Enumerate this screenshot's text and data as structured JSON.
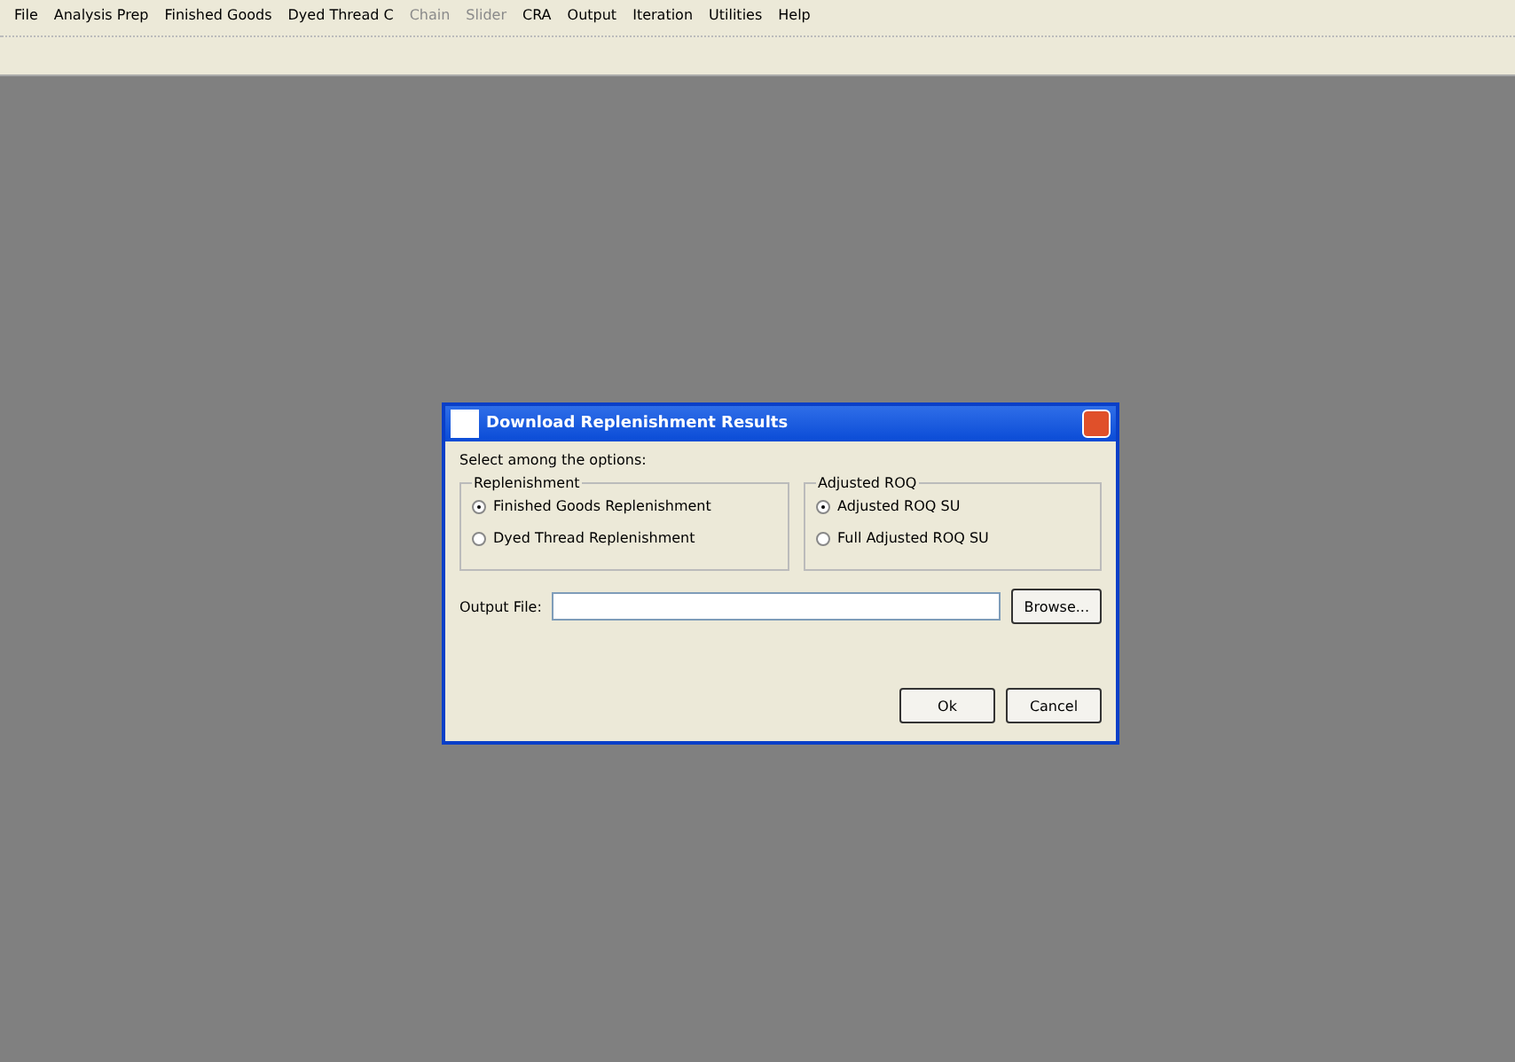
{
  "menu": [
    {
      "label": "File",
      "disabled": false
    },
    {
      "label": "Analysis Prep",
      "disabled": false
    },
    {
      "label": "Finished Goods",
      "disabled": false
    },
    {
      "label": "Dyed Thread C",
      "disabled": false
    },
    {
      "label": "Chain",
      "disabled": true
    },
    {
      "label": "Slider",
      "disabled": true
    },
    {
      "label": "CRA",
      "disabled": false
    },
    {
      "label": "Output",
      "disabled": false
    },
    {
      "label": "Iteration",
      "disabled": false
    },
    {
      "label": "Utilities",
      "disabled": false
    },
    {
      "label": "Help",
      "disabled": false
    }
  ],
  "dialog": {
    "title": "Download Replenishment Results",
    "prompt": "Select among the options:",
    "groups": [
      {
        "label": "Replenishment",
        "options": [
          {
            "label": "Finished Goods Replenishment",
            "selected": true
          },
          {
            "label": "Dyed Thread Replenishment",
            "selected": false
          }
        ]
      },
      {
        "label": "Adjusted ROQ",
        "options": [
          {
            "label": "Adjusted ROQ SU",
            "selected": true
          },
          {
            "label": "Full Adjusted ROQ SU",
            "selected": false
          }
        ]
      }
    ],
    "output_label": "Output File:",
    "browse": "Browse...",
    "buttons": [
      "Ok",
      "Cancel"
    ]
  }
}
